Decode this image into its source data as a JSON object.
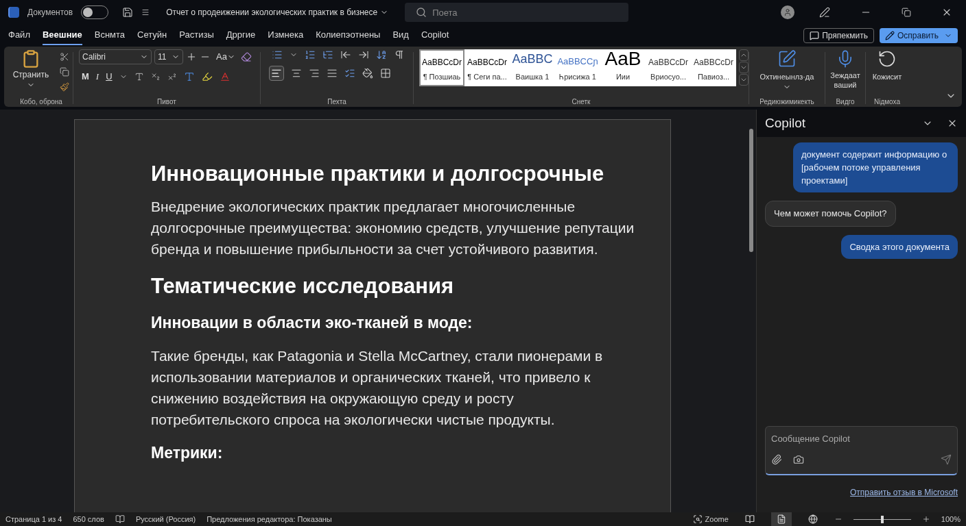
{
  "titlebar": {
    "autosave_label": "Документов",
    "autosave_on": false,
    "doc_title": "Отчет о продеижении экологических практик в бизнесе",
    "search_placeholder": "Поета"
  },
  "menu_tabs": [
    {
      "label": "Файл",
      "selected": false
    },
    {
      "label": "Веешние",
      "selected": true
    },
    {
      "label": "Вснмта",
      "selected": false
    },
    {
      "label": "Сетуйн",
      "selected": false
    },
    {
      "label": "Растизы",
      "selected": false
    },
    {
      "label": "Дрргие",
      "selected": false
    },
    {
      "label": "Измнека",
      "selected": false
    },
    {
      "label": "Колиепэотнены",
      "selected": false
    },
    {
      "label": "Вид",
      "selected": false
    },
    {
      "label": "Copilot",
      "selected": false
    }
  ],
  "header_buttons": {
    "comment": "Пряпекмить",
    "edit": "Осправить"
  },
  "ribbon": {
    "clipboard": {
      "paste": "Странить",
      "group": "Кобо, оброна"
    },
    "font": {
      "family": "Calibri",
      "size": "11",
      "case_button": "Aa",
      "format_buttons": [
        "M",
        "I",
        "U"
      ],
      "group": "Пивот"
    },
    "paragraph": {
      "group": "Пехта"
    },
    "styles": {
      "group": "Снетк",
      "items": [
        {
          "kind": "normal",
          "sample": "AaBBCcDr",
          "name": "¶ Позшиаь",
          "selected": true
        },
        {
          "kind": "normal",
          "sample": "AaBBCcDr",
          "name": "¶ Сеги па...",
          "selected": false
        },
        {
          "kind": "heading1",
          "sample": "AaBBC",
          "name": "Ваишка 1",
          "selected": false
        },
        {
          "kind": "heading2",
          "sample": "AaBBCCɲ",
          "name": "Ꮒрисижа 1",
          "selected": false
        },
        {
          "kind": "title",
          "sample": "AaB",
          "name": "Иии",
          "selected": false
        },
        {
          "kind": "subtle",
          "sample": "AaBBCcDr",
          "name": "Вриосуо...",
          "selected": false
        },
        {
          "kind": "subtle",
          "sample": "AaBBCcDr",
          "name": "Павиоз...",
          "selected": false
        }
      ]
    },
    "editing": {
      "label": "Охтинеынлз·да",
      "group": "Редиюжимикекть"
    },
    "voice": {
      "label": "Зеждаат ваший",
      "group": "Видго"
    },
    "reuse": {
      "label": "Кожисит",
      "group": "Nідмоха"
    }
  },
  "document": {
    "blocks": [
      {
        "kind": "heading1",
        "text": "Инновационные практики и долгосрочные"
      },
      {
        "kind": "paragraph",
        "text": "Внедрение экологических практик предлагает многочисленные долгосрочные преимущества: экономию средств, улучшение репутации бренда и повышение прибыльности за счет устойчивого развития."
      },
      {
        "kind": "heading1",
        "text": "Тематические исследования"
      },
      {
        "kind": "heading2",
        "text": "Инновации в области эко-тканей в моде:"
      },
      {
        "kind": "paragraph",
        "text": "Такие бренды, как Patagonia и Stella McCartney, стали пионерами в использовании материалов и органических тканей, что привело к снижению воздействия на окружающую среду и росту потребительского спроса на экологически чистые продукты."
      },
      {
        "kind": "heading2",
        "text": "Метрики:"
      }
    ]
  },
  "copilot": {
    "title": "Copilot",
    "messages": [
      {
        "kind": "user",
        "text": "документ содержит информацию о [рабочем потоке управления проектами]"
      },
      {
        "kind": "assistant",
        "text": "Чем может помочь Copilot?"
      },
      {
        "kind": "user",
        "text": "Сводка этого документа"
      }
    ],
    "input_placeholder": "Сообщение Copilot",
    "feedback_link": "Отправить отзыв в Microsoft"
  },
  "status_bar": {
    "left": [
      "Страница 1 из 4",
      "650 слов"
    ],
    "language": "Русский (Россия)",
    "editor": "Предложения редактора: Показаны",
    "focus": "Zoome",
    "views": [
      {
        "kind": "read",
        "selected": false
      },
      {
        "kind": "print",
        "selected": true
      },
      {
        "kind": "web",
        "selected": false
      }
    ],
    "zoom": {
      "level": 0.5,
      "reading": "100%"
    }
  }
}
